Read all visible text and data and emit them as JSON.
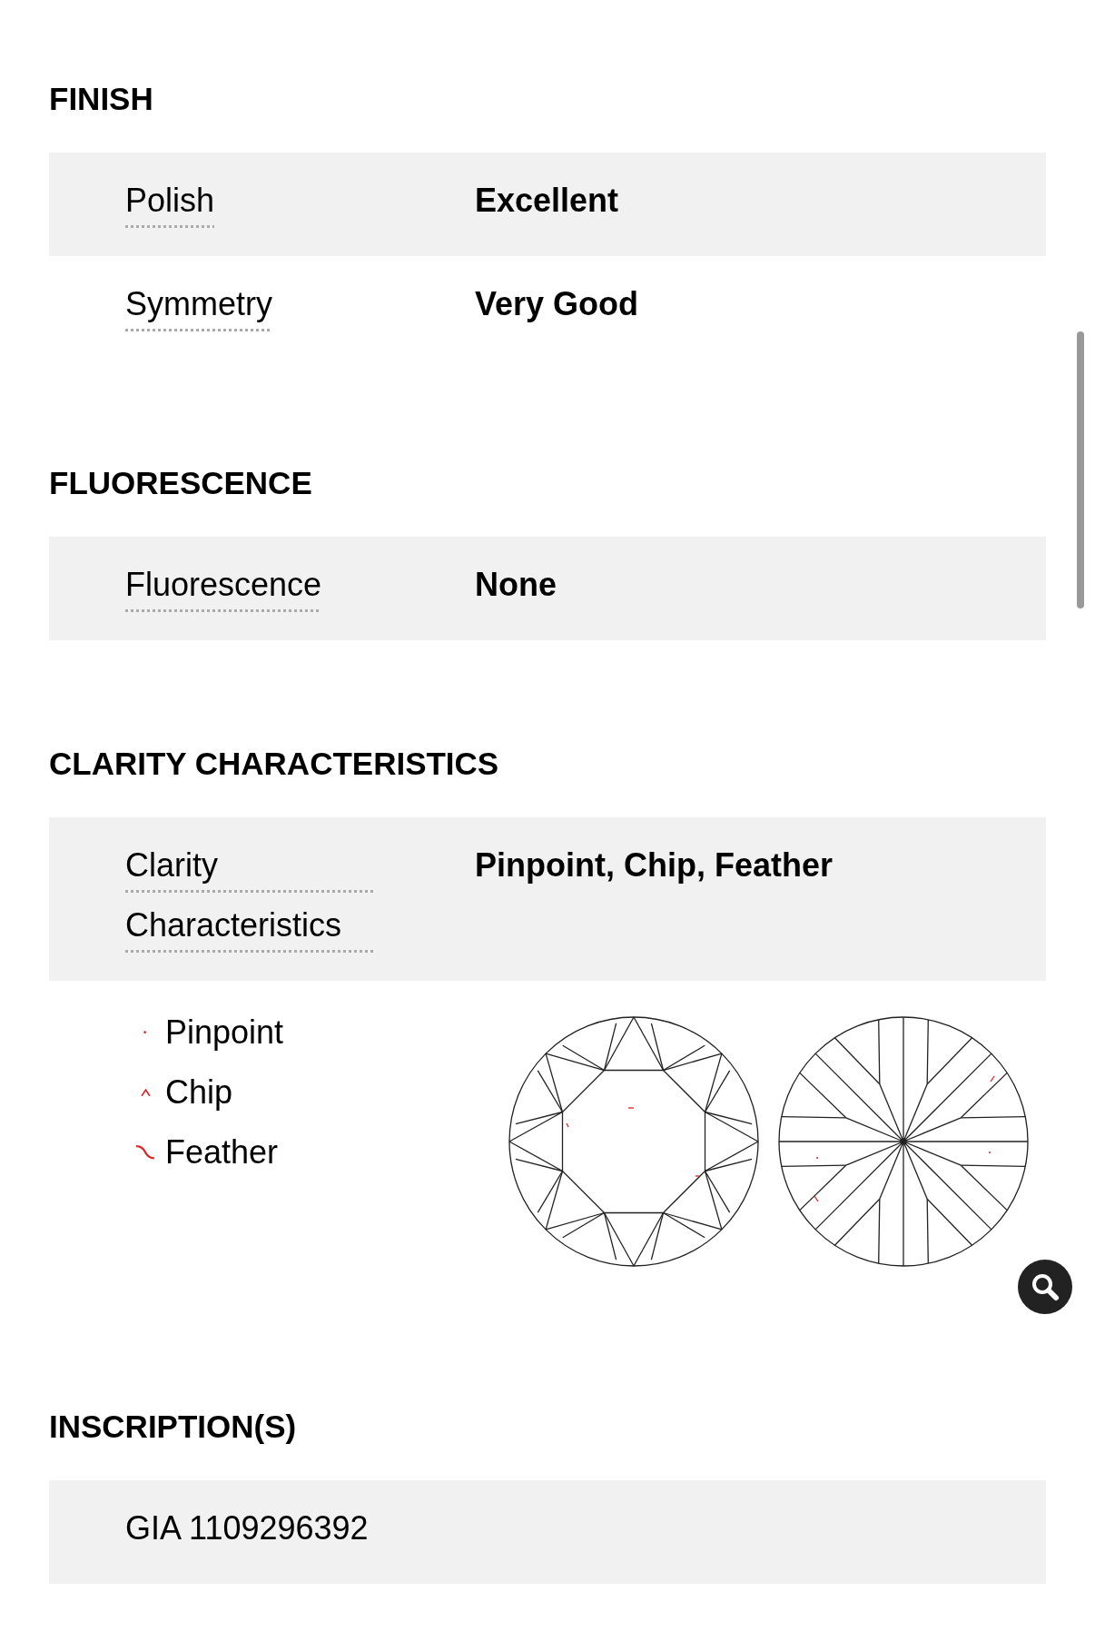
{
  "sections": [
    {
      "heading": "FINISH",
      "rows": [
        {
          "label": "Polish",
          "value": "Excellent"
        },
        {
          "label": "Symmetry",
          "value": "Very Good"
        }
      ]
    },
    {
      "heading": "FLUORESCENCE",
      "rows": [
        {
          "label": "Fluorescence",
          "value": "None"
        }
      ]
    },
    {
      "heading": "CLARITY CHARACTERISTICS",
      "rows": [
        {
          "label": "Clarity Characteristics",
          "value": "Pinpoint, Chip, Feather"
        }
      ],
      "legend": [
        {
          "kind": "pinpoint",
          "label": "Pinpoint"
        },
        {
          "kind": "chip",
          "label": "Chip"
        },
        {
          "kind": "feather",
          "label": "Feather"
        }
      ]
    },
    {
      "heading": "INSCRIPTION(S)",
      "rows": [
        {
          "label": "GIA 1109296392"
        }
      ]
    }
  ]
}
